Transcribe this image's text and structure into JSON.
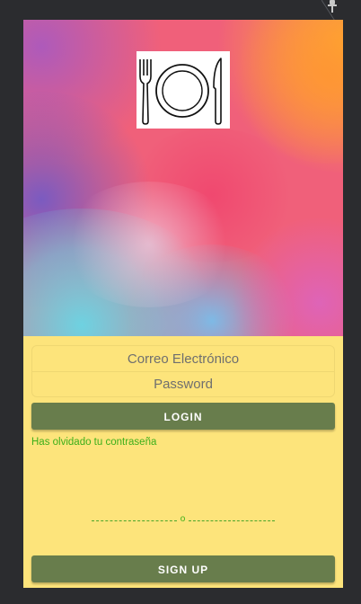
{
  "login_form": {
    "email_placeholder": "Correo Electrónico",
    "password_placeholder": "Password",
    "login_button": "LOGIN",
    "forgot_password": "Has olvidado tu contraseña",
    "separator_text": "o",
    "signup_button": "SIGN UP"
  },
  "icons": {
    "logo": "fork-plate-knife-icon",
    "top_right": "pin-icon"
  },
  "colors": {
    "form_background": "#fde47b",
    "button": "#687d4c",
    "link_text": "#3caf1a",
    "frame": "#2b2c2f"
  }
}
